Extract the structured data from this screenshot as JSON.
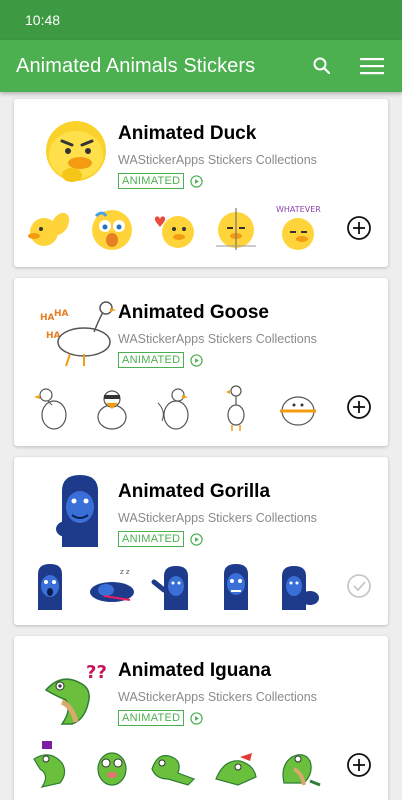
{
  "status_bar": {
    "time": "10:48"
  },
  "app_bar": {
    "title": "Animated Animals Stickers"
  },
  "colors": {
    "primary": "#4caf50",
    "primary_dark": "#3d9a42",
    "badge": "#4caf50"
  },
  "packs": [
    {
      "name": "Animated Duck",
      "publisher": "WAStickerApps Stickers Collections",
      "badge": "ANIMATED",
      "action_icon": "add-circle-icon"
    },
    {
      "name": "Animated Goose",
      "publisher": "WAStickerApps Stickers Collections",
      "badge": "ANIMATED",
      "action_icon": "add-circle-icon"
    },
    {
      "name": "Animated Gorilla",
      "publisher": "WAStickerApps Stickers Collections",
      "badge": "ANIMATED",
      "action_icon": "added-check-icon"
    },
    {
      "name": "Animated Iguana",
      "publisher": "WAStickerApps Stickers Collections",
      "badge": "ANIMATED",
      "action_icon": "add-circle-icon"
    }
  ],
  "sticker_texts": {
    "ha1": "HA",
    "ha2": "HA",
    "ha3": "HA",
    "whatever": "WHATEVER"
  }
}
